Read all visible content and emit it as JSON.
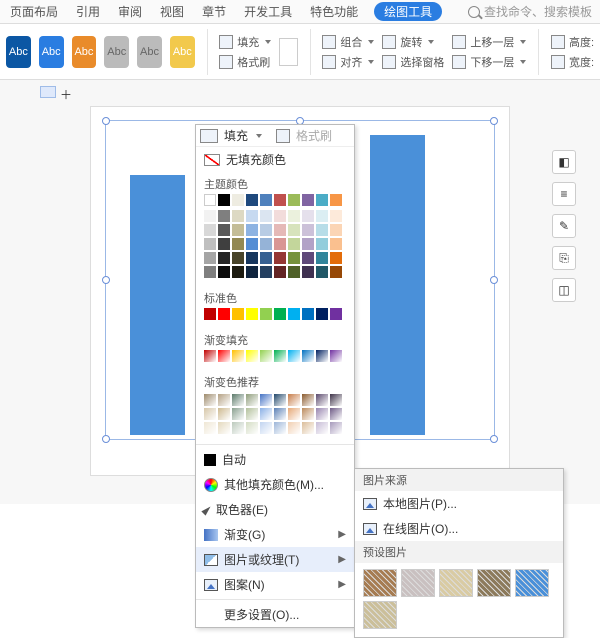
{
  "tabs": {
    "t1": "页面布局",
    "t2": "引用",
    "t3": "审阅",
    "t4": "视图",
    "t5": "章节",
    "t6": "开发工具",
    "t7": "特色功能",
    "t8": "绘图工具",
    "search": "查找命令、搜索模板"
  },
  "style_label": "Abc",
  "ribbon": {
    "fill": "填充",
    "format_painter": "格式刷",
    "group": "组合",
    "align": "对齐",
    "rotate": "旋转",
    "select_pane": "选择窗格",
    "up": "上移一层",
    "down": "下移一层",
    "height": "高度:",
    "width": "宽度:"
  },
  "dropdown": {
    "no_fill": "无填充颜色",
    "theme": "主题颜色",
    "standard": "标准色",
    "gradient_fill": "渐变填充",
    "gradient_rec": "渐变色推荐",
    "auto": "自动",
    "more_color": "其他填充颜色(M)...",
    "eyedropper": "取色器(E)",
    "gradient": "渐变(G)",
    "picture_texture": "图片或纹理(T)",
    "pattern": "图案(N)",
    "more": "更多设置(O)...",
    "theme_row1": [
      "#ffffff",
      "#000000",
      "#eeece1",
      "#1f497d",
      "#4f81bd",
      "#c0504d",
      "#9bbb59",
      "#8064a2",
      "#4bacc6",
      "#f79646"
    ],
    "theme_shades": [
      [
        "#f2f2f2",
        "#7f7f7f",
        "#ddd9c3",
        "#c6d9f0",
        "#dbe5f1",
        "#f2dcdb",
        "#ebf1dd",
        "#e5e0ec",
        "#dbeef3",
        "#fdeada"
      ],
      [
        "#d8d8d8",
        "#595959",
        "#c4bd97",
        "#8db3e2",
        "#b8cce4",
        "#e5b9b7",
        "#d7e3bc",
        "#ccc1d9",
        "#b7dde8",
        "#fbd5b5"
      ],
      [
        "#bfbfbf",
        "#3f3f3f",
        "#938953",
        "#548dd4",
        "#95b3d7",
        "#d99694",
        "#c3d69b",
        "#b2a2c7",
        "#92cddc",
        "#fac08f"
      ],
      [
        "#a5a5a5",
        "#262626",
        "#494429",
        "#17365d",
        "#366092",
        "#953734",
        "#76923c",
        "#5f497a",
        "#31859b",
        "#e36c09"
      ],
      [
        "#7f7f7f",
        "#0c0c0c",
        "#1d1b10",
        "#0f243e",
        "#244061",
        "#632423",
        "#4f6128",
        "#3f3151",
        "#205867",
        "#974806"
      ]
    ],
    "standard_colors": [
      "#c00000",
      "#ff0000",
      "#ffc000",
      "#ffff00",
      "#92d050",
      "#00b050",
      "#00b0f0",
      "#0070c0",
      "#002060",
      "#7030a0"
    ],
    "gradient_colors": [
      "#c00000",
      "#ff0000",
      "#ffc000",
      "#ffff00",
      "#92d050",
      "#00b050",
      "#00b0f0",
      "#0070c0",
      "#002060",
      "#7030a0"
    ],
    "grad_rec": [
      [
        "#9e8a6c",
        "#b4a183",
        "#5c7a6a",
        "#8f9e7c",
        "#4472c4",
        "#22486b",
        "#c77d4a",
        "#8a5a2e",
        "#5b4a6e",
        "#3e3248"
      ],
      [
        "#d6c6a8",
        "#cdb98f",
        "#8aa190",
        "#b2c09b",
        "#8ab0e6",
        "#5b80b5",
        "#e6a877",
        "#bb8a5c",
        "#9784af",
        "#6e5a86"
      ],
      [
        "#efe7d5",
        "#e4d9bd",
        "#bccabd",
        "#d4ddc4",
        "#c1d4f0",
        "#9db6d9",
        "#f1cfb1",
        "#dbbd9a",
        "#c7bcd6",
        "#a699bb"
      ]
    ]
  },
  "submenu": {
    "source": "图片来源",
    "local": "本地图片(P)...",
    "online": "在线图片(O)...",
    "preset": "预设图片",
    "textures": [
      "#a67c52",
      "#c9c0c0",
      "#d9cba3",
      "#8c7a5b",
      "#4a90d9",
      "#cbbf9a"
    ]
  }
}
